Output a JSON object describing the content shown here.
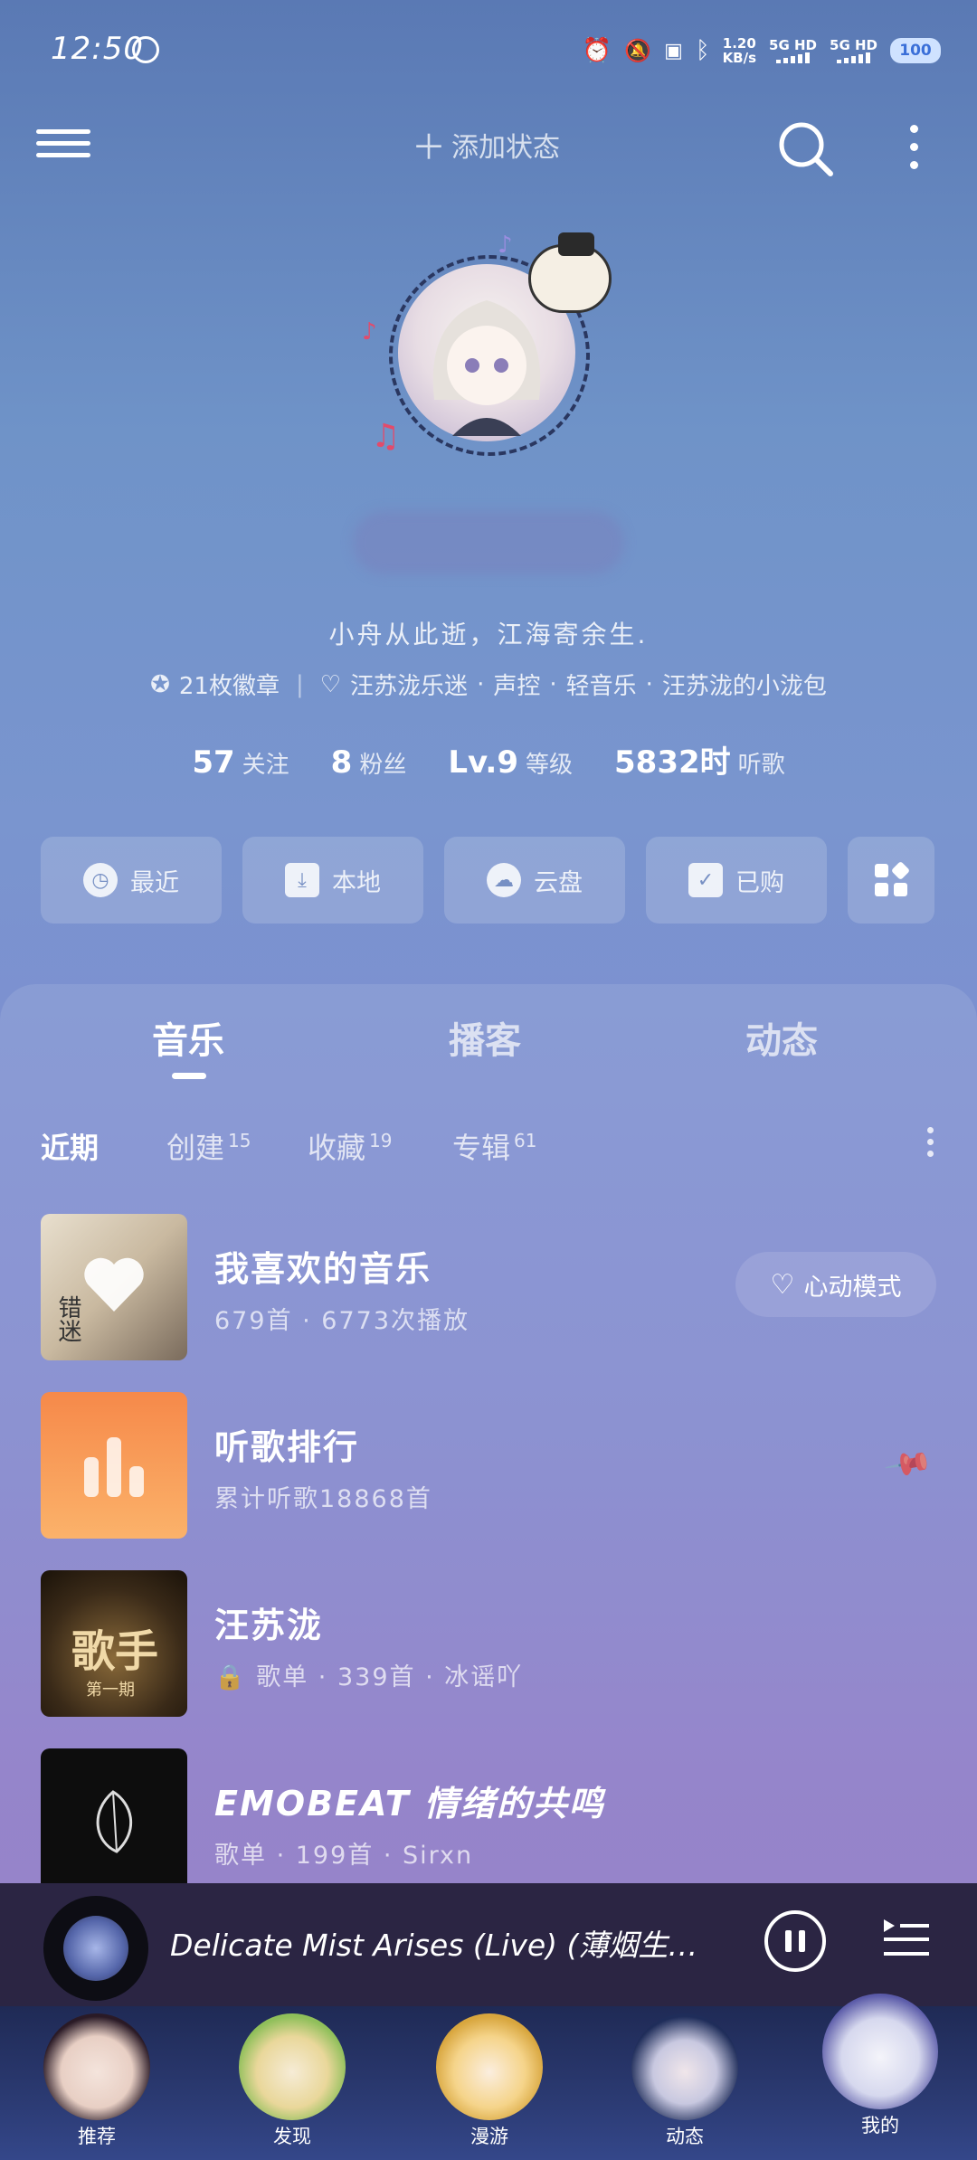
{
  "status_bar": {
    "time": "12:50",
    "net_speed_top": "1.20",
    "net_speed_bottom": "KB/s",
    "signal1": "5G HD",
    "signal2": "5G HD",
    "battery": "100"
  },
  "top_bar": {
    "add_status": "添加状态"
  },
  "profile": {
    "signature": "小舟从此逝，江海寄余生.",
    "badges": "21枚徽章",
    "tags": [
      "汪苏泷乐迷",
      "声控",
      "轻音乐",
      "汪苏泷的小泷包"
    ],
    "stats": [
      {
        "value": "57",
        "label": "关注"
      },
      {
        "value": "8",
        "label": "粉丝"
      },
      {
        "value": "Lv.9",
        "label": "等级"
      },
      {
        "value": "5832时",
        "label": "听歌"
      }
    ]
  },
  "quick_actions": [
    "最近",
    "本地",
    "云盘",
    "已购"
  ],
  "tabs": [
    "音乐",
    "播客",
    "动态"
  ],
  "subtabs": [
    {
      "label": "近期",
      "count": ""
    },
    {
      "label": "创建",
      "count": "15"
    },
    {
      "label": "收藏",
      "count": "19"
    },
    {
      "label": "专辑",
      "count": "61"
    }
  ],
  "list": [
    {
      "title": "我喜欢的音乐",
      "sub": "679首 · 6773次播放",
      "cover_text": "错迷"
    },
    {
      "title": "听歌排行",
      "sub": "累计听歌18868首"
    },
    {
      "title": "汪苏泷",
      "sub": "歌单 · 339首 · 冰谣吖",
      "cover_text": "歌手",
      "cover_sub": "第一期"
    },
    {
      "title": "EMOBEAT 情绪的共鸣",
      "sub": "歌单 · 199首 · Sirxn"
    }
  ],
  "heart_mode": "心动模式",
  "player": {
    "title": "Delicate Mist Arises (Live) (薄烟生)…"
  },
  "nav": [
    "推荐",
    "发现",
    "漫游",
    "动态",
    "我的"
  ],
  "colors": {
    "accent_orange": "#f7893e",
    "player_bg": "#2b2543",
    "nav_bg": "#2b3a72"
  }
}
